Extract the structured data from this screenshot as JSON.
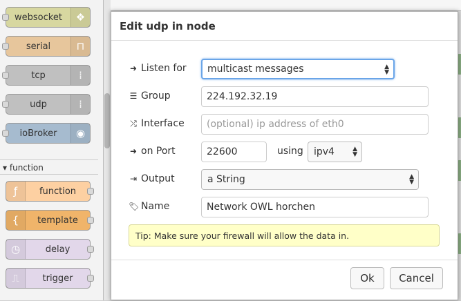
{
  "palette": {
    "nodes": [
      {
        "label": "websocket",
        "color": "#d7d7a0",
        "icon": "globe-icon",
        "glyph": "❖"
      },
      {
        "label": "serial",
        "color": "#e7c69c",
        "icon": "serial-icon",
        "glyph": "⊓"
      },
      {
        "label": "tcp",
        "color": "#c0c0c0",
        "icon": "bridge-icon",
        "glyph": "⁞"
      },
      {
        "label": "udp",
        "color": "#c0c0c0",
        "icon": "bridge-icon",
        "glyph": "⁞"
      },
      {
        "label": "ioBroker",
        "color": "#a6bbcf",
        "icon": "iobroker-icon",
        "glyph": "◉"
      }
    ],
    "category": "function",
    "function_nodes": [
      {
        "label": "function",
        "color": "#fdd0a2",
        "icon": "function-icon",
        "glyph": "ƒ"
      },
      {
        "label": "template",
        "color": "#f0b46a",
        "icon": "template-icon",
        "glyph": "{"
      },
      {
        "label": "delay",
        "color": "#e2d7ea",
        "icon": "timer-icon",
        "glyph": "◷"
      },
      {
        "label": "trigger",
        "color": "#e2d7ea",
        "icon": "trigger-icon",
        "glyph": "⎍"
      }
    ]
  },
  "dialog": {
    "title": "Edit udp in node",
    "listen_label": "Listen for",
    "listen_value": "multicast messages",
    "group_label": "Group",
    "group_value": "224.192.32.19",
    "interface_label": "Interface",
    "interface_placeholder": "(optional) ip address of eth0",
    "port_label": "on Port",
    "port_value": "22600",
    "using_label": "using",
    "ipver_value": "ipv4",
    "output_label": "Output",
    "output_value": "a String",
    "name_label": "Name",
    "name_value": "Network OWL horchen",
    "tip": "Tip: Make sure your firewall will allow the data in.",
    "ok_label": "Ok",
    "cancel_label": "Cancel"
  }
}
